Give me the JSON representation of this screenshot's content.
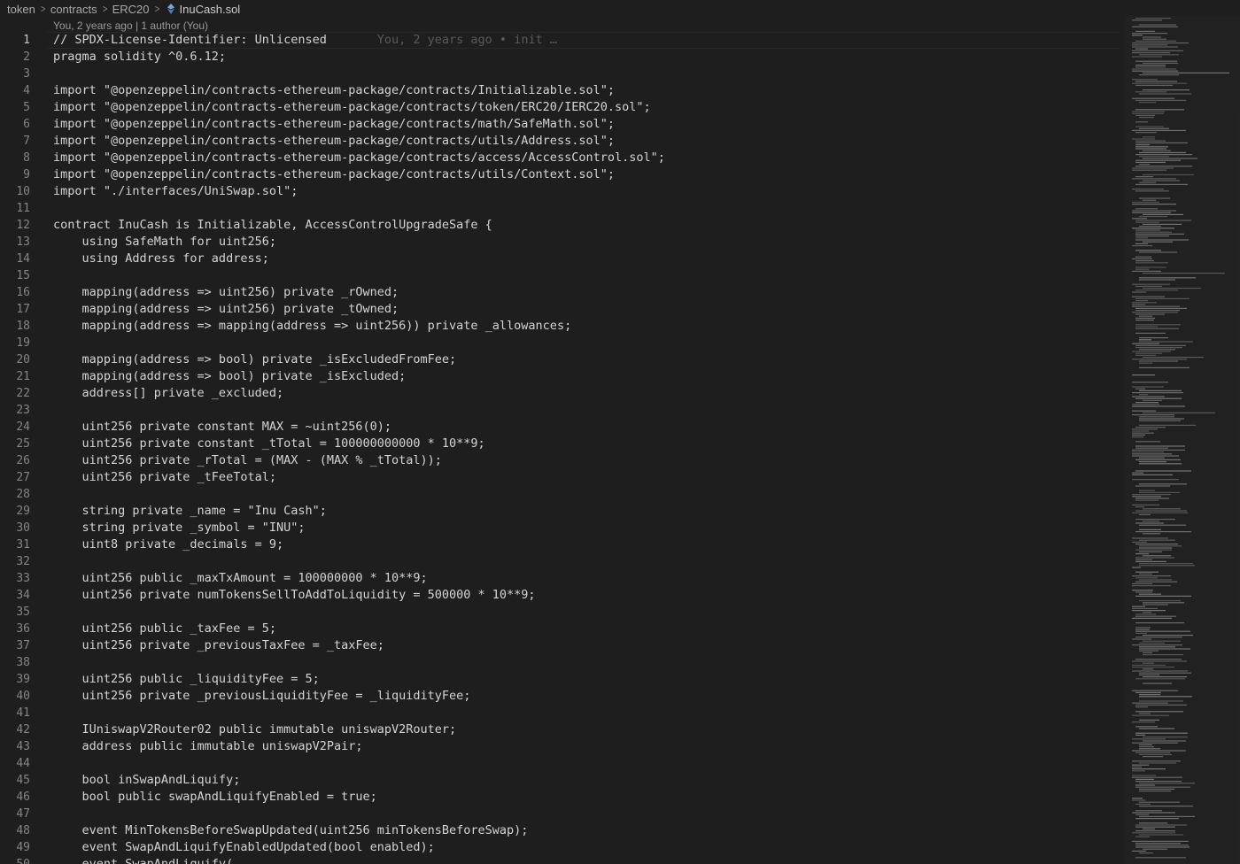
{
  "breadcrumb": {
    "items": [
      "token",
      "contracts",
      "ERC20"
    ],
    "file": "InuCash.sol"
  },
  "codelens": "You, 2 years ago | 1 author (You)",
  "editor": {
    "current_line": 1,
    "blame_annotation": "You, 2 years ago • init …",
    "lines": [
      {
        "n": "1",
        "text": "// SPDX-License-Identifier: Unlicensed"
      },
      {
        "n": "2",
        "text": "pragma solidity ^0.6.12;"
      },
      {
        "n": "3",
        "text": ""
      },
      {
        "n": "4",
        "text": "import \"@openzeppelin/contracts-ethereum-package/contracts/Initializable.sol\";"
      },
      {
        "n": "5",
        "text": "import \"@openzeppelin/contracts-ethereum-package/contracts/token/ERC20/IERC20.sol\";"
      },
      {
        "n": "6",
        "text": "import \"@openzeppelin/contracts-ethereum-package/contracts/math/SafeMath.sol\";"
      },
      {
        "n": "7",
        "text": "import \"@openzeppelin/contracts-ethereum-package/contracts/utils/Address.sol\";"
      },
      {
        "n": "8",
        "text": "import \"@openzeppelin/contracts-ethereum-package/contracts/access/AccessControl.sol\";"
      },
      {
        "n": "9",
        "text": "import \"@openzeppelin/contracts-ethereum-package/contracts/utils/Context.sol\";"
      },
      {
        "n": "10",
        "text": "import \"./interfaces/UniSwap.sol\";"
      },
      {
        "n": "11",
        "text": ""
      },
      {
        "n": "12",
        "text": "contract InuCash is Initializable, AccessControlUpgradeSafe {"
      },
      {
        "n": "13",
        "text": "    using SafeMath for uint256;"
      },
      {
        "n": "14",
        "text": "    using Address for address;"
      },
      {
        "n": "15",
        "text": ""
      },
      {
        "n": "16",
        "text": "    mapping(address => uint256) private _rOwned;"
      },
      {
        "n": "17",
        "text": "    mapping(address => uint256) private _tOwned;"
      },
      {
        "n": "18",
        "text": "    mapping(address => mapping(address => uint256)) private _allowances;"
      },
      {
        "n": "19",
        "text": ""
      },
      {
        "n": "20",
        "text": "    mapping(address => bool) private _isExcludedFromFee;"
      },
      {
        "n": "21",
        "text": "    mapping(address => bool) private _isExcluded;"
      },
      {
        "n": "22",
        "text": "    address[] private _excluded;"
      },
      {
        "n": "23",
        "text": ""
      },
      {
        "n": "24",
        "text": "    uint256 private constant MAX = ~uint256(0);"
      },
      {
        "n": "25",
        "text": "    uint256 private constant _tTotal = 100000000000 * 10**9;"
      },
      {
        "n": "26",
        "text": "    uint256 private _rTotal = (MAX - (MAX % _tTotal));"
      },
      {
        "n": "27",
        "text": "    uint256 private _tFeeTotal;"
      },
      {
        "n": "28",
        "text": ""
      },
      {
        "n": "29",
        "text": "    string private _name = \"Inu Cash\";"
      },
      {
        "n": "30",
        "text": "    string private _symbol = \"INU\";"
      },
      {
        "n": "31",
        "text": "    uint8 private _decimals = 9;"
      },
      {
        "n": "32",
        "text": ""
      },
      {
        "n": "33",
        "text": "    uint256 public _maxTxAmount = 100000000 * 10**9;"
      },
      {
        "n": "34",
        "text": "    uint256 private numTokensSellToAddToLiquidity = 500000 * 10**9;"
      },
      {
        "n": "35",
        "text": ""
      },
      {
        "n": "36",
        "text": "    uint256 public _taxFee = 5;"
      },
      {
        "n": "37",
        "text": "    uint256 private _previousTaxFee = _taxFee;"
      },
      {
        "n": "38",
        "text": ""
      },
      {
        "n": "39",
        "text": "    uint256 public _liquidityFee = 5;"
      },
      {
        "n": "40",
        "text": "    uint256 private _previousLiquidityFee = _liquidityFee;"
      },
      {
        "n": "41",
        "text": ""
      },
      {
        "n": "42",
        "text": "    IUniswapV2Router02 public immutable uniswapV2Router;"
      },
      {
        "n": "43",
        "text": "    address public immutable uniswapV2Pair;"
      },
      {
        "n": "44",
        "text": ""
      },
      {
        "n": "45",
        "text": "    bool inSwapAndLiquify;"
      },
      {
        "n": "46",
        "text": "    bool public swapAndLiquifyEnabled = true;"
      },
      {
        "n": "47",
        "text": ""
      },
      {
        "n": "48",
        "text": "    event MinTokensBeforeSwapUpdated(uint256 minTokensBeforeSwap);"
      },
      {
        "n": "49",
        "text": "    event SwapAndLiquifyEnabledUpdated(bool enabled);"
      },
      {
        "n": "50",
        "text": "    event SwapAndLiquify("
      }
    ]
  }
}
